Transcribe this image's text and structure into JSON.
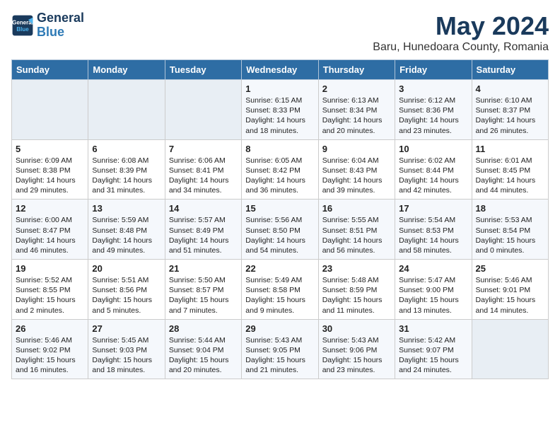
{
  "logo": {
    "line1": "General",
    "line2": "Blue"
  },
  "title": "May 2024",
  "subtitle": "Baru, Hunedoara County, Romania",
  "days_of_week": [
    "Sunday",
    "Monday",
    "Tuesday",
    "Wednesday",
    "Thursday",
    "Friday",
    "Saturday"
  ],
  "weeks": [
    [
      {
        "num": "",
        "info": ""
      },
      {
        "num": "",
        "info": ""
      },
      {
        "num": "",
        "info": ""
      },
      {
        "num": "1",
        "info": "Sunrise: 6:15 AM\nSunset: 8:33 PM\nDaylight: 14 hours\nand 18 minutes."
      },
      {
        "num": "2",
        "info": "Sunrise: 6:13 AM\nSunset: 8:34 PM\nDaylight: 14 hours\nand 20 minutes."
      },
      {
        "num": "3",
        "info": "Sunrise: 6:12 AM\nSunset: 8:36 PM\nDaylight: 14 hours\nand 23 minutes."
      },
      {
        "num": "4",
        "info": "Sunrise: 6:10 AM\nSunset: 8:37 PM\nDaylight: 14 hours\nand 26 minutes."
      }
    ],
    [
      {
        "num": "5",
        "info": "Sunrise: 6:09 AM\nSunset: 8:38 PM\nDaylight: 14 hours\nand 29 minutes."
      },
      {
        "num": "6",
        "info": "Sunrise: 6:08 AM\nSunset: 8:39 PM\nDaylight: 14 hours\nand 31 minutes."
      },
      {
        "num": "7",
        "info": "Sunrise: 6:06 AM\nSunset: 8:41 PM\nDaylight: 14 hours\nand 34 minutes."
      },
      {
        "num": "8",
        "info": "Sunrise: 6:05 AM\nSunset: 8:42 PM\nDaylight: 14 hours\nand 36 minutes."
      },
      {
        "num": "9",
        "info": "Sunrise: 6:04 AM\nSunset: 8:43 PM\nDaylight: 14 hours\nand 39 minutes."
      },
      {
        "num": "10",
        "info": "Sunrise: 6:02 AM\nSunset: 8:44 PM\nDaylight: 14 hours\nand 42 minutes."
      },
      {
        "num": "11",
        "info": "Sunrise: 6:01 AM\nSunset: 8:45 PM\nDaylight: 14 hours\nand 44 minutes."
      }
    ],
    [
      {
        "num": "12",
        "info": "Sunrise: 6:00 AM\nSunset: 8:47 PM\nDaylight: 14 hours\nand 46 minutes."
      },
      {
        "num": "13",
        "info": "Sunrise: 5:59 AM\nSunset: 8:48 PM\nDaylight: 14 hours\nand 49 minutes."
      },
      {
        "num": "14",
        "info": "Sunrise: 5:57 AM\nSunset: 8:49 PM\nDaylight: 14 hours\nand 51 minutes."
      },
      {
        "num": "15",
        "info": "Sunrise: 5:56 AM\nSunset: 8:50 PM\nDaylight: 14 hours\nand 54 minutes."
      },
      {
        "num": "16",
        "info": "Sunrise: 5:55 AM\nSunset: 8:51 PM\nDaylight: 14 hours\nand 56 minutes."
      },
      {
        "num": "17",
        "info": "Sunrise: 5:54 AM\nSunset: 8:53 PM\nDaylight: 14 hours\nand 58 minutes."
      },
      {
        "num": "18",
        "info": "Sunrise: 5:53 AM\nSunset: 8:54 PM\nDaylight: 15 hours\nand 0 minutes."
      }
    ],
    [
      {
        "num": "19",
        "info": "Sunrise: 5:52 AM\nSunset: 8:55 PM\nDaylight: 15 hours\nand 2 minutes."
      },
      {
        "num": "20",
        "info": "Sunrise: 5:51 AM\nSunset: 8:56 PM\nDaylight: 15 hours\nand 5 minutes."
      },
      {
        "num": "21",
        "info": "Sunrise: 5:50 AM\nSunset: 8:57 PM\nDaylight: 15 hours\nand 7 minutes."
      },
      {
        "num": "22",
        "info": "Sunrise: 5:49 AM\nSunset: 8:58 PM\nDaylight: 15 hours\nand 9 minutes."
      },
      {
        "num": "23",
        "info": "Sunrise: 5:48 AM\nSunset: 8:59 PM\nDaylight: 15 hours\nand 11 minutes."
      },
      {
        "num": "24",
        "info": "Sunrise: 5:47 AM\nSunset: 9:00 PM\nDaylight: 15 hours\nand 13 minutes."
      },
      {
        "num": "25",
        "info": "Sunrise: 5:46 AM\nSunset: 9:01 PM\nDaylight: 15 hours\nand 14 minutes."
      }
    ],
    [
      {
        "num": "26",
        "info": "Sunrise: 5:46 AM\nSunset: 9:02 PM\nDaylight: 15 hours\nand 16 minutes."
      },
      {
        "num": "27",
        "info": "Sunrise: 5:45 AM\nSunset: 9:03 PM\nDaylight: 15 hours\nand 18 minutes."
      },
      {
        "num": "28",
        "info": "Sunrise: 5:44 AM\nSunset: 9:04 PM\nDaylight: 15 hours\nand 20 minutes."
      },
      {
        "num": "29",
        "info": "Sunrise: 5:43 AM\nSunset: 9:05 PM\nDaylight: 15 hours\nand 21 minutes."
      },
      {
        "num": "30",
        "info": "Sunrise: 5:43 AM\nSunset: 9:06 PM\nDaylight: 15 hours\nand 23 minutes."
      },
      {
        "num": "31",
        "info": "Sunrise: 5:42 AM\nSunset: 9:07 PM\nDaylight: 15 hours\nand 24 minutes."
      },
      {
        "num": "",
        "info": ""
      }
    ]
  ]
}
